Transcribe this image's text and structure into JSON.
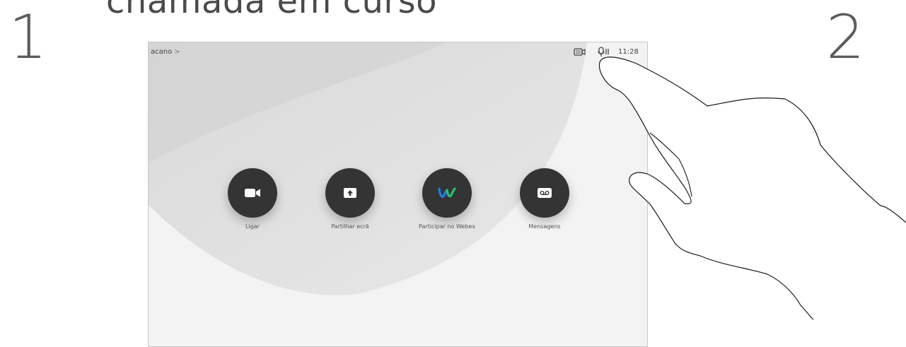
{
  "step_numbers": [
    "1",
    "2"
  ],
  "heading": "chamada em curso",
  "status_bar": {
    "site_name": "acano",
    "chevron": ">",
    "time": "11:28",
    "icons": [
      "camera-settings-icon",
      "microphone-mute-icon"
    ]
  },
  "actions": [
    {
      "label": "Ligar",
      "icon": "video-camera-icon"
    },
    {
      "label": "Partilhar ecrã",
      "icon": "share-screen-icon"
    },
    {
      "label": "Participar no Webex",
      "icon": "webex-logo-icon"
    },
    {
      "label": "Mensagens",
      "icon": "voicemail-icon"
    }
  ],
  "colors": {
    "button_bg": "#343434",
    "screen_bg": "#f4f4f4",
    "number_gray": "#5c5c5c",
    "webex_blue": "#1a7ee6",
    "webex_green": "#27c46a"
  }
}
